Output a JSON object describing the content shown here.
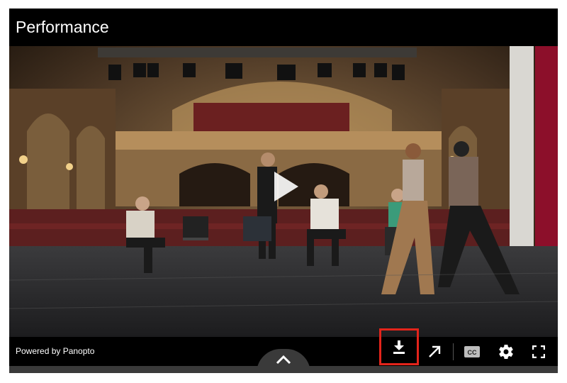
{
  "player": {
    "title": "Performance",
    "powered_by": "Powered by Panopto"
  },
  "controls": {
    "download_icon": "download-icon",
    "share_icon": "open-external-icon",
    "cc_label": "CC",
    "settings_icon": "gear-icon",
    "fullscreen_icon": "fullscreen-icon",
    "expand_icon": "chevron-up-icon"
  },
  "colors": {
    "highlight": "#e3241b",
    "bar": "#000000",
    "strip": "#3a3a3a"
  }
}
